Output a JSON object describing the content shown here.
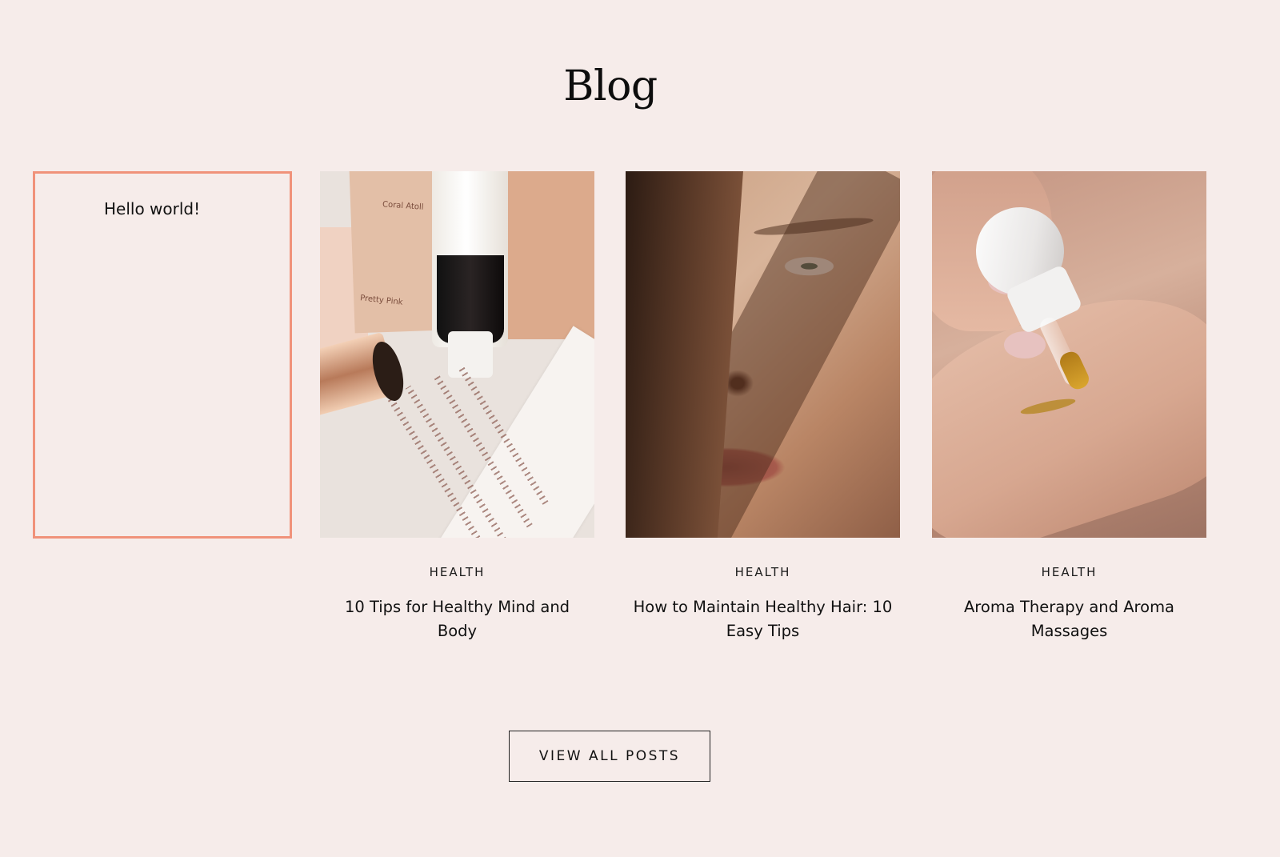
{
  "page": {
    "title": "Blog"
  },
  "placeholder_card": {
    "text": "Hello world!"
  },
  "posts": [
    {
      "category": "HEALTH",
      "title": "10 Tips for Healthy Mind and Body"
    },
    {
      "category": "HEALTH",
      "title": "How to Maintain Healthy Hair: 10 Easy Tips"
    },
    {
      "category": "HEALTH",
      "title": "Aroma Therapy and Aroma Massages"
    }
  ],
  "view_all": {
    "label": "VIEW ALL POSTS"
  },
  "colors": {
    "background": "#f6ecea",
    "accent_border": "#f0927a",
    "text": "#111111"
  },
  "image_labels": {
    "swatch_1": "Coral Atoll",
    "swatch_2": "Pretty Pink"
  }
}
